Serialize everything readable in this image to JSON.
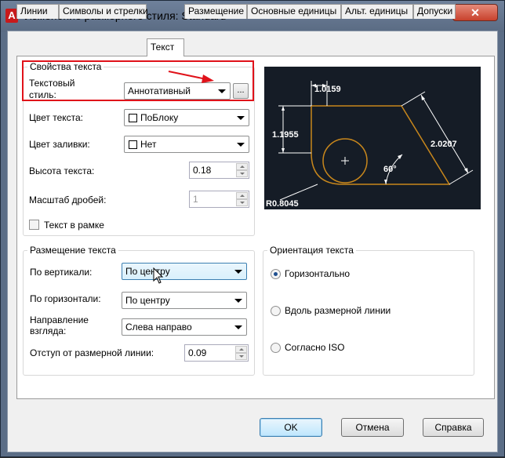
{
  "window": {
    "title": "Изменение размерного стиля: Standard",
    "close_glyph": "✕",
    "app_icon_letter": "A"
  },
  "tabs": [
    {
      "label": "Линии"
    },
    {
      "label": "Символы и стрелки"
    },
    {
      "label": "Текст"
    },
    {
      "label": "Размещение"
    },
    {
      "label": "Основные единицы"
    },
    {
      "label": "Альт. единицы"
    },
    {
      "label": "Допуски"
    }
  ],
  "text_props": {
    "group_title": "Свойства текста",
    "style_label_1": "Текстовый",
    "style_label_2": "стиль:",
    "style_value": "Аннотативный",
    "browse_label": "...",
    "color_label": "Цвет текста:",
    "color_value": "ПоБлоку",
    "fill_label": "Цвет заливки:",
    "fill_value": "Нет",
    "height_label": "Высота текста:",
    "height_value": "0.18",
    "fraction_label": "Масштаб дробей:",
    "fraction_value": "1",
    "frame_label": "Текст в рамке"
  },
  "placement": {
    "group_title": "Размещение текста",
    "vertical_label": "По вертикали:",
    "vertical_value": "По центру",
    "horizontal_label": "По горизонтали:",
    "horizontal_value": "По центру",
    "direction_label_1": "Направление",
    "direction_label_2": "взгляда:",
    "direction_value": "Слева направо",
    "offset_label": "Отступ от размерной линии:",
    "offset_value": "0.09"
  },
  "orientation": {
    "group_title": "Ориентация текста",
    "options": [
      {
        "label": "Горизонтально",
        "selected": true
      },
      {
        "label": "Вдоль размерной линии",
        "selected": false
      },
      {
        "label": "Согласно ISO",
        "selected": false
      }
    ]
  },
  "preview": {
    "dim_top": "1.0159",
    "dim_left": "1.1955",
    "dim_right": "2.0207",
    "angle": "60°",
    "radius": "R0.8045"
  },
  "buttons": {
    "ok": "OK",
    "cancel": "Отмена",
    "help": "Справка"
  },
  "colors": {
    "annotation_outline": "#e0121a",
    "preview_bg": "#151c26",
    "geometry": "#c8871c"
  }
}
